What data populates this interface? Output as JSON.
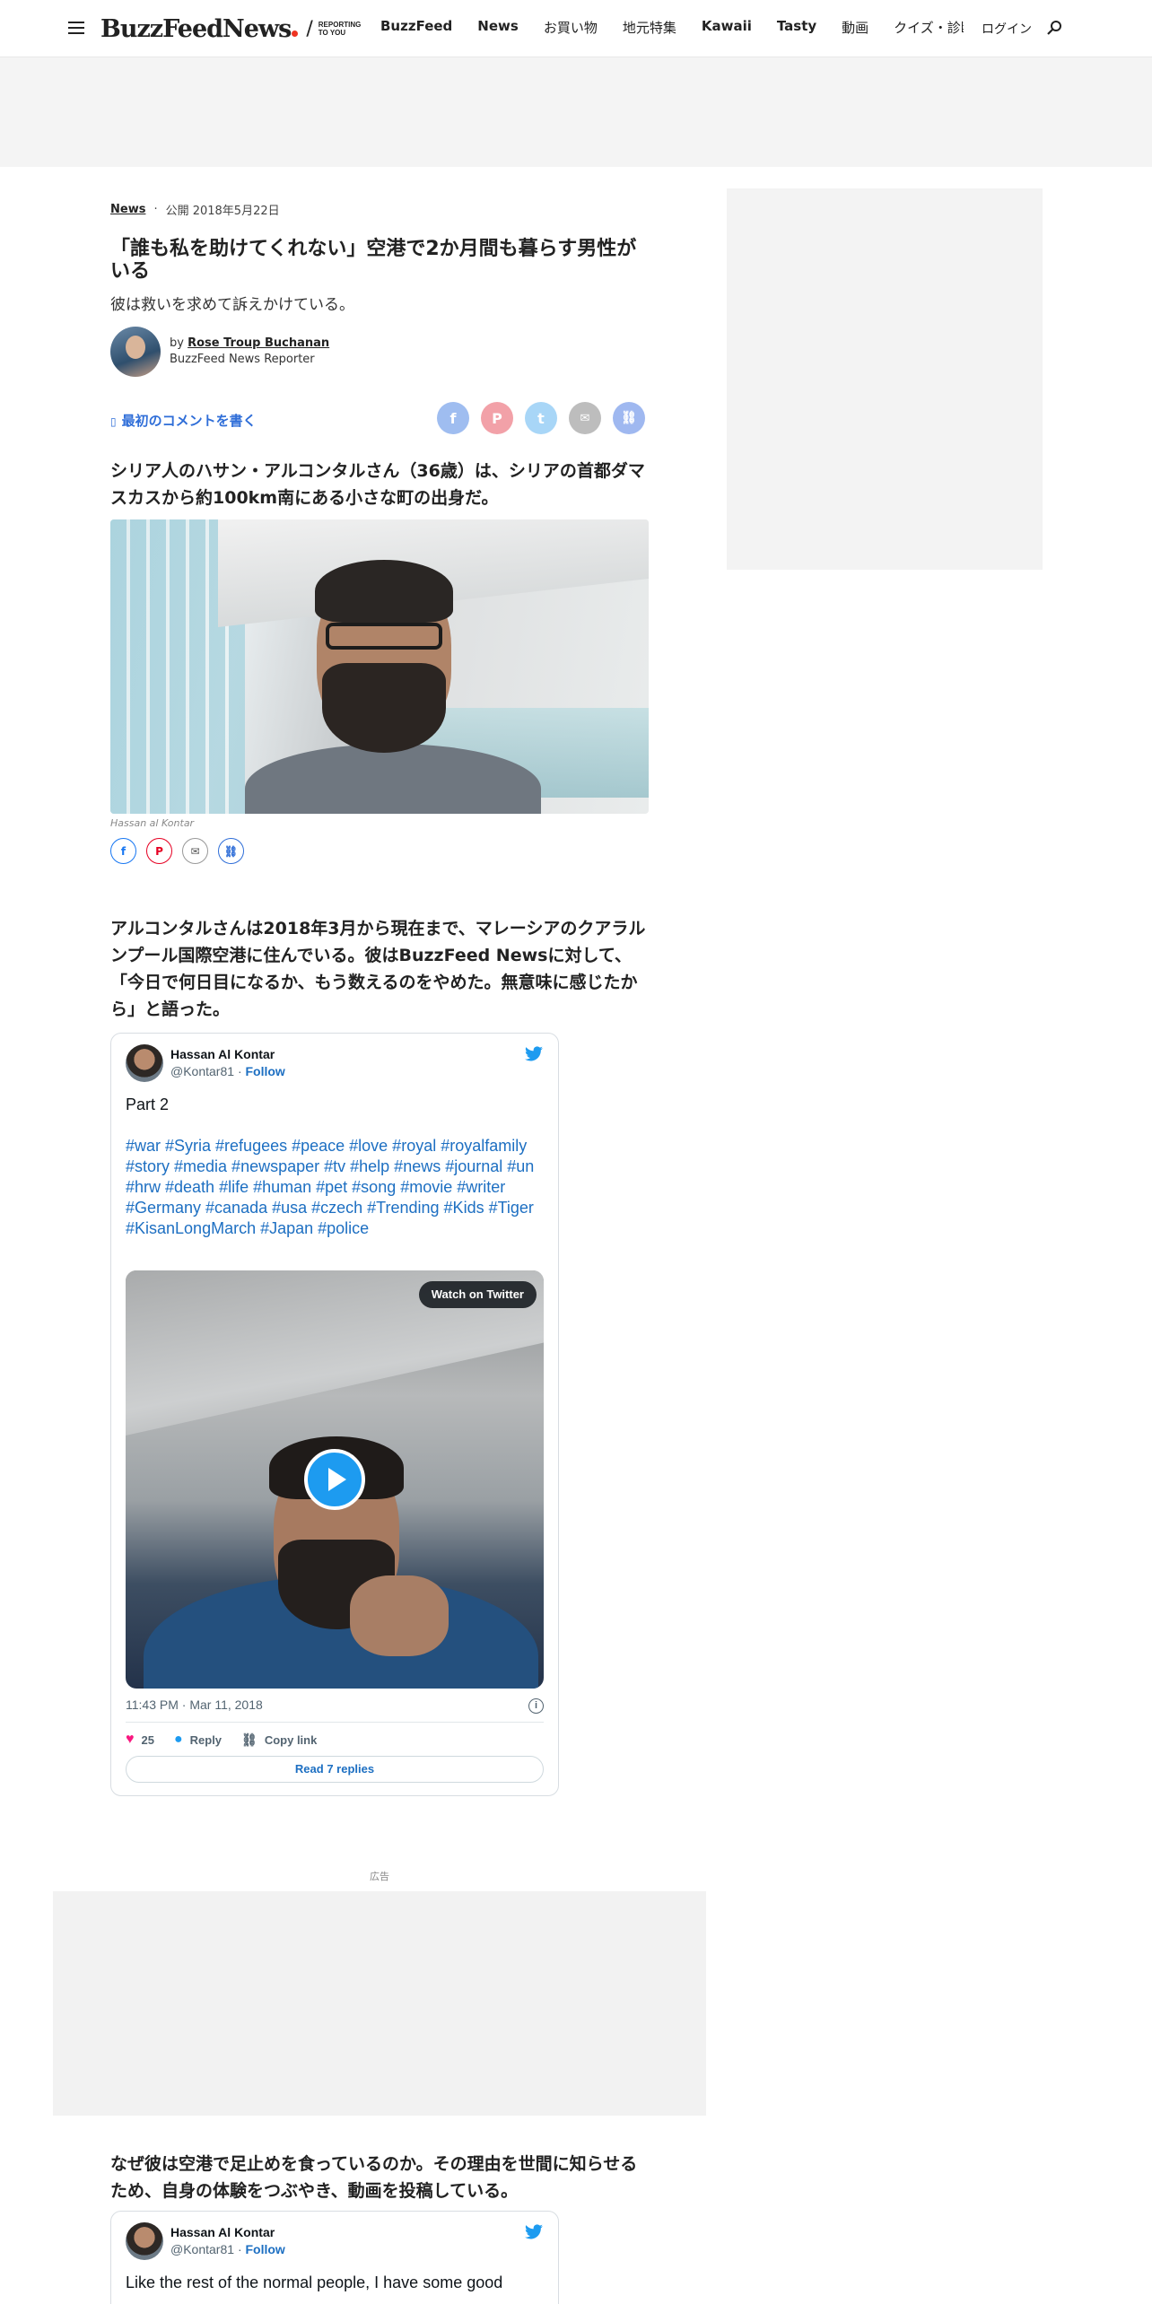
{
  "header": {
    "logo_text": "BuzzFeed",
    "logo_text2": "News",
    "logo_tagline_1": "REPORTING",
    "logo_tagline_2": "TO YOU",
    "nav": [
      "BuzzFeed",
      "News",
      "お買い物",
      "地元特集",
      "Kawaii",
      "Tasty",
      "動画",
      "クイズ・診断"
    ],
    "login": "ログイン"
  },
  "article": {
    "category": "News",
    "published": "公開 2018年5月22日",
    "title": "「誰も私を助けてくれない」空港で2か月間も暮らす男性がいる",
    "subtitle": "彼は救いを求めて訴えかけている。",
    "byline_prefix": "by",
    "author": "Rose Troup Buchanan",
    "author_role": "BuzzFeed News Reporter",
    "comment_link": "最初のコメントを書く",
    "para1": "シリア人のハサン・アルコンタルさん（36歳）は、シリアの首都ダマスカスから約100km南にある小さな町の出身だ。",
    "photo_caption": "Hassan al Kontar",
    "para2": "アルコンタルさんは2018年3月から現在まで、マレーシアのクアラルンプール国際空港に住んでいる。彼はBuzzFeed Newsに対して、「今日で何日目になるか、もう数えるのをやめた。無意味に感じたから」と語った。",
    "ad_label": "広告",
    "para3": "なぜ彼は空港で足止めを食っているのか。その理由を世間に知らせるため、自身の体験をつぶやき、動画を投稿している。"
  },
  "tweet1": {
    "name": "Hassan Al Kontar",
    "handle": "@Kontar81",
    "sep": "·",
    "follow": "Follow",
    "text": "Part 2",
    "tags": "#war #Syria #refugees  #peace #love #royal #royalfamily #story #media #newspaper #tv #help #news #journal #un #hrw #death #life #human #pet #song #movie #writer #Germany #canada #usa #czech #Trending #Kids #Tiger #KisanLongMarch #Japan #police",
    "watch": "Watch on Twitter",
    "time": "11:43 PM · Mar 11, 2018",
    "likes": "25",
    "reply": "Reply",
    "copy": "Copy link",
    "read_replies": "Read 7 replies"
  },
  "tweet2": {
    "name": "Hassan Al Kontar",
    "handle": "@Kontar81",
    "sep": "·",
    "follow": "Follow",
    "text": "Like the rest of the normal people, I have some good"
  },
  "colors": {
    "link_blue": "#2f6ed8",
    "twitter_blue": "#1d9bf0",
    "facebook": "#9fbdf0",
    "pinterest": "#f2a1a8",
    "twitter_share": "#a8d6f7",
    "mail": "#bdbdbd",
    "copy": "#9fb8f0"
  }
}
